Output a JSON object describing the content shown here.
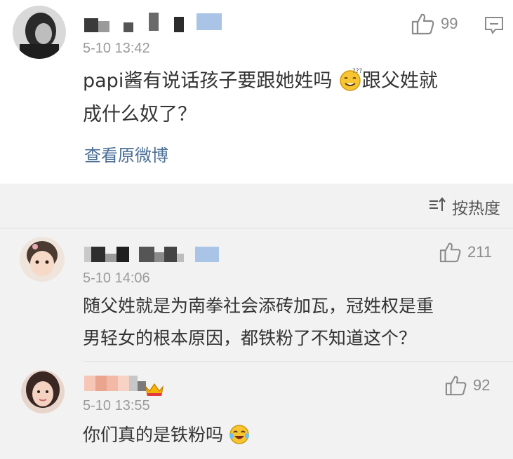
{
  "post": {
    "time": "5-10 13:42",
    "likes": "99",
    "text_line1": "papi酱有说话孩子要跟她姓吗",
    "text_line1b": "跟父姓就",
    "text_line2": "成什么奴了？",
    "view_original": "查看原微博",
    "emoji_icon": "thinking-face-icon",
    "comment_icon": "comment-icon",
    "like_icon": "thumbs-up-icon"
  },
  "sort": {
    "label": "按热度",
    "icon": "sort-icon"
  },
  "comments": [
    {
      "time": "5-10 14:06",
      "likes": "211",
      "text_line1": "随父姓就是为南拳社会添砖加瓦，冠姓权是重",
      "text_line2": "男轻女的根本原因，都铁粉了不知道这个？"
    },
    {
      "time": "5-10 13:55",
      "likes": "92",
      "text_line1": "你们真的是铁粉吗",
      "emoji_icon": "laughing-crying-face-icon",
      "badge_icon": "vip-crown-badge-icon"
    }
  ],
  "colors": {
    "link": "#4a6e97",
    "muted": "#9a9a9a",
    "background": "#f2f2f2"
  }
}
